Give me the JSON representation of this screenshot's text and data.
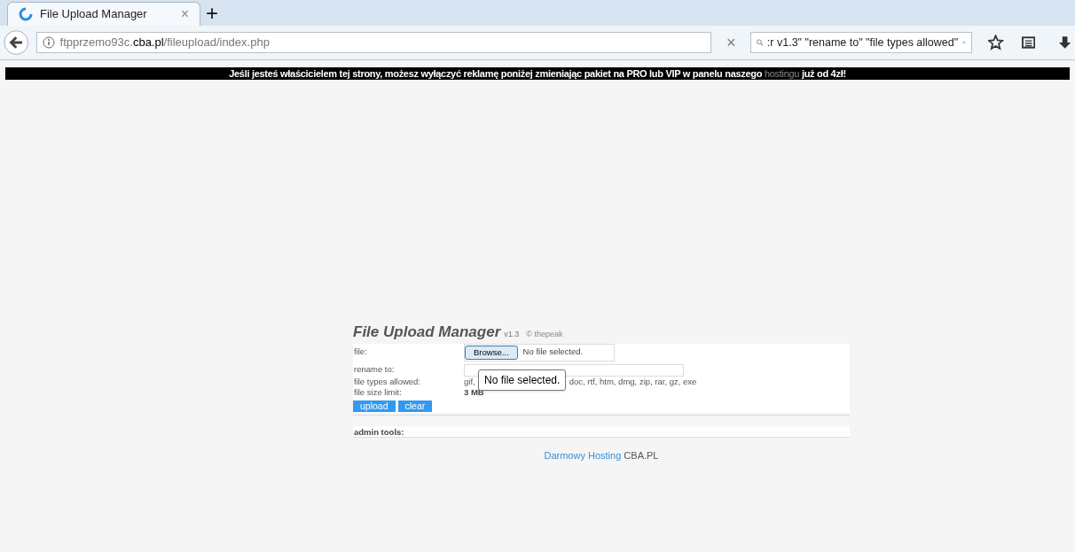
{
  "browser": {
    "tab": {
      "title": "File Upload Manager",
      "close": "×",
      "selected": true
    },
    "new_tab": "+",
    "url": {
      "subdomain": "ftpprzemo93c.",
      "domain": "cba.pl",
      "path": "/fileupload/index.php"
    },
    "clear": "×",
    "search": {
      "value": ":r v1.3\" \"rename to\" \"file types allowed\""
    }
  },
  "banner": {
    "before": "Jeśli jesteś właścicielem tej strony, możesz wyłączyć reklamę poniżej zmieniając pakiet na PRO lub VIP w panelu naszego",
    "link": "hostingu",
    "after": "już od 4zł!"
  },
  "app": {
    "title": "File Upload Manager",
    "version": "v1.3",
    "credit": "© thepeak"
  },
  "form": [
    {
      "label": "file:",
      "kind": "file",
      "button": "Browse...",
      "value": "No file selected."
    },
    {
      "label": "rename to:",
      "kind": "input"
    },
    {
      "label": "file types allowed:",
      "kind": "text",
      "parts": [
        "gif,",
        "doc, rtf, htm, dmg, zip, rar, gz, exe"
      ]
    },
    {
      "label": "file size limit:",
      "kind": "text",
      "parts": [
        "3 MB"
      ]
    }
  ],
  "tooltip": "No file selected.",
  "buttons": [
    "upload",
    "clear"
  ],
  "admin": "admin tools:",
  "footer": {
    "link": "Darmowy Hosting",
    "text": "CBA.PL"
  }
}
